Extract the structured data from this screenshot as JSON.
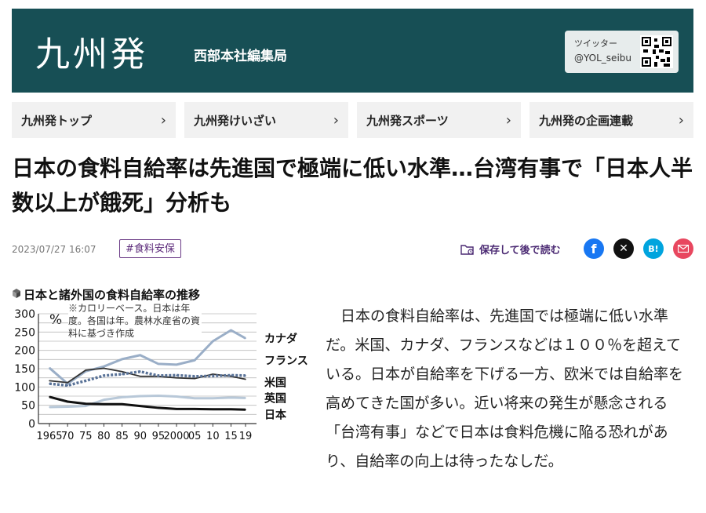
{
  "header": {
    "title": "九州発",
    "subtitle": "西部本社編集局",
    "twitter_label": "ツイッター",
    "twitter_handle": "@YOL_seibu"
  },
  "nav": {
    "items": [
      {
        "label": "九州発トップ"
      },
      {
        "label": "九州発けいざい"
      },
      {
        "label": "九州発スポーツ"
      },
      {
        "label": "九州発の企画連載"
      }
    ]
  },
  "article": {
    "headline": "日本の食料自給率は先進国で極端に低い水準…台湾有事で「日本人半数以上が餓死」分析も",
    "date": "2023/07/27 16:07",
    "tag": "#食料安保",
    "save_label": "保存して後で読む",
    "share_hatena": "B!",
    "body": "　日本の食料自給率は、先進国では極端に低い水準だ。米国、カナダ、フランスなどは１００％を超えている。日本が自給率を下げる一方、欧米では自給率を高めてきた国が多い。近い将来の発生が懸念される「台湾有事」などで日本は食料危機に陥る恐れがあり、自給率の向上は待ったなしだ。"
  },
  "colors": {
    "banner": "#174f55",
    "tag": "#5b2a7a",
    "facebook": "#1877f2",
    "x": "#111111",
    "hatena": "#00a4de",
    "mail": "#e8475f",
    "canada": "#9aaec7",
    "france": "#5a7398",
    "usa": "#333333",
    "uk": "#b8c8d8",
    "japan": "#111111"
  },
  "chart_data": {
    "type": "line",
    "title": "日本と諸外国の食料自給率の推移",
    "ylabel": "%",
    "note": "※カロリーベース。日本は年度。各国は年。農林水産省の資料に基づき作成",
    "x_tick_labels": [
      "1965",
      "70",
      "75",
      "80",
      "85",
      "90",
      "95",
      "2000",
      "05",
      "10",
      "15",
      "19"
    ],
    "x": [
      1965,
      1970,
      1975,
      1980,
      1985,
      1990,
      1995,
      2000,
      2005,
      2010,
      2015,
      2019
    ],
    "ylim": [
      0,
      300
    ],
    "y_ticks": [
      0,
      25,
      50,
      75,
      100,
      125,
      150,
      175,
      200,
      225,
      250,
      275,
      300
    ],
    "series": [
      {
        "name": "カナダ",
        "values": [
          152,
          109,
          143,
          156,
          176,
          187,
          163,
          161,
          173,
          225,
          255,
          233
        ]
      },
      {
        "name": "フランス",
        "values": [
          109,
          104,
          117,
          131,
          135,
          142,
          131,
          132,
          129,
          130,
          132,
          131
        ]
      },
      {
        "name": "米国",
        "values": [
          117,
          112,
          146,
          151,
          142,
          129,
          129,
          125,
          123,
          135,
          129,
          121
        ]
      },
      {
        "name": "英国",
        "values": [
          45,
          46,
          48,
          65,
          72,
          75,
          76,
          74,
          69,
          69,
          71,
          70
        ]
      },
      {
        "name": "日本",
        "values": [
          73,
          60,
          54,
          53,
          53,
          48,
          43,
          40,
          40,
          39,
          39,
          38
        ]
      }
    ]
  }
}
